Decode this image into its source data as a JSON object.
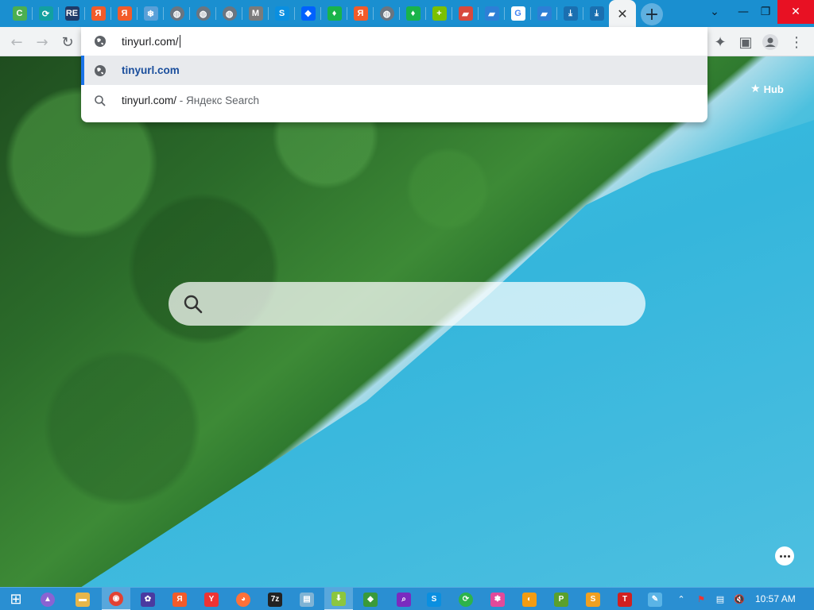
{
  "tabs": [
    {
      "icon": "c-app-icon",
      "glyph": "C",
      "color": "#4caf50"
    },
    {
      "icon": "reload-app-icon",
      "glyph": "⟳",
      "color": "#12a0a0"
    },
    {
      "icon": "re-app-icon",
      "glyph": "RE",
      "color": "#1f3a68"
    },
    {
      "icon": "yandex-icon",
      "glyph": "Я",
      "color": "#f25b2a"
    },
    {
      "icon": "yandex-icon",
      "glyph": "Я",
      "color": "#f25b2a"
    },
    {
      "icon": "snowflake-icon",
      "glyph": "❄",
      "color": "#5aa0d8"
    },
    {
      "icon": "globe-icon",
      "glyph": "◍",
      "color": "#6b7580"
    },
    {
      "icon": "globe-icon",
      "glyph": "◍",
      "color": "#6b7580"
    },
    {
      "icon": "globe-icon",
      "glyph": "◍",
      "color": "#6b7580"
    },
    {
      "icon": "m-app-icon",
      "glyph": "M",
      "color": "#7b7b7b"
    },
    {
      "icon": "skype-icon",
      "glyph": "S",
      "color": "#0a8fe0"
    },
    {
      "icon": "dropbox-icon",
      "glyph": "❖",
      "color": "#0061fe"
    },
    {
      "icon": "leaf-icon",
      "glyph": "♦",
      "color": "#19b34a"
    },
    {
      "icon": "yandex-icon",
      "glyph": "Я",
      "color": "#f25b2a"
    },
    {
      "icon": "globe-icon",
      "glyph": "◍",
      "color": "#6b7580"
    },
    {
      "icon": "leaf-icon",
      "glyph": "♦",
      "color": "#19b34a"
    },
    {
      "icon": "plus-app-icon",
      "glyph": "+",
      "color": "#7cc000"
    },
    {
      "icon": "folder-app-icon",
      "glyph": "▰",
      "color": "#d8493d"
    },
    {
      "icon": "bookmark-app-icon",
      "glyph": "▰",
      "color": "#2d7fd6"
    },
    {
      "icon": "google-icon",
      "glyph": "G",
      "color": "#ffffff"
    },
    {
      "icon": "bookmark-app-icon",
      "glyph": "▰",
      "color": "#2d7fd6"
    },
    {
      "icon": "download-icon",
      "glyph": "⤓",
      "color": "#1a6fb0"
    },
    {
      "icon": "download-icon",
      "glyph": "⤓",
      "color": "#1a6fb0"
    }
  ],
  "active_tab": {
    "close_glyph": "✕"
  },
  "new_tab": {
    "glyph": "+"
  },
  "window_controls": {
    "dropdown": "⌄",
    "minimize": "—",
    "restore": "❐",
    "close": "✕"
  },
  "toolbar": {
    "back": "←",
    "forward": "→",
    "reload": "↻",
    "extensions": "✦",
    "side_panel": "▣",
    "profile": "●",
    "menu": "⋮"
  },
  "omnibox": {
    "typed": "tinyurl.com/",
    "suggestions": [
      {
        "text": "tinyurl.com",
        "sub": "",
        "icon": "globe-icon",
        "selected": true
      },
      {
        "text": "tinyurl.com/",
        "sub": " - Яндекс Search",
        "icon": "search-icon",
        "selected": false
      }
    ]
  },
  "page": {
    "hub_label": "Hub",
    "search_placeholder": ""
  },
  "taskbar": {
    "items": [
      {
        "icon": "start-windows-icon",
        "glyph": "⊞",
        "color": "transparent"
      },
      {
        "icon": "cortana-icon",
        "glyph": "▲",
        "color": "#8a63d2"
      },
      {
        "icon": "file-explorer-icon",
        "glyph": "▬",
        "color": "#e8b64a"
      },
      {
        "icon": "chrome-icon",
        "glyph": "◉",
        "color": "#e34133"
      },
      {
        "icon": "settings-app-icon",
        "glyph": "✿",
        "color": "#4a3aa0"
      },
      {
        "icon": "yandex-icon",
        "glyph": "Я",
        "color": "#f25b2a"
      },
      {
        "icon": "yandex-browser-icon",
        "glyph": "Y",
        "color": "#e33"
      },
      {
        "icon": "firefox-icon",
        "glyph": "◕",
        "color": "#ff7139"
      },
      {
        "icon": "7zip-icon",
        "glyph": "7z",
        "color": "#222"
      },
      {
        "icon": "notepad-icon",
        "glyph": "▤",
        "color": "#7fb3d5"
      },
      {
        "icon": "download-manager-icon",
        "glyph": "⬇",
        "color": "#8cc63f"
      },
      {
        "icon": "network-app-icon",
        "glyph": "◆",
        "color": "#3a9a3a"
      },
      {
        "icon": "search-app-icon",
        "glyph": "⌕",
        "color": "#7a2bbf"
      },
      {
        "icon": "skype-icon",
        "glyph": "S",
        "color": "#0a8fe0"
      },
      {
        "icon": "sync-app-icon",
        "glyph": "⟳",
        "color": "#2db34a"
      },
      {
        "icon": "pinwheel-app-icon",
        "glyph": "✽",
        "color": "#e24a9a"
      },
      {
        "icon": "color-app-icon",
        "glyph": "◐",
        "color": "#f39c12"
      },
      {
        "icon": "p-app-icon",
        "glyph": "P",
        "color": "#5aa02c"
      },
      {
        "icon": "s-app-icon",
        "glyph": "S",
        "color": "#f0a020"
      },
      {
        "icon": "t-app-icon",
        "glyph": "T",
        "color": "#d02020"
      },
      {
        "icon": "pen-app-icon",
        "glyph": "✎",
        "color": "#5ab4e6"
      }
    ],
    "tray": {
      "up_arrow": "⌃",
      "flag": "⚑",
      "network": "▤",
      "volume": "🔇"
    },
    "clock": "10:57 AM"
  }
}
